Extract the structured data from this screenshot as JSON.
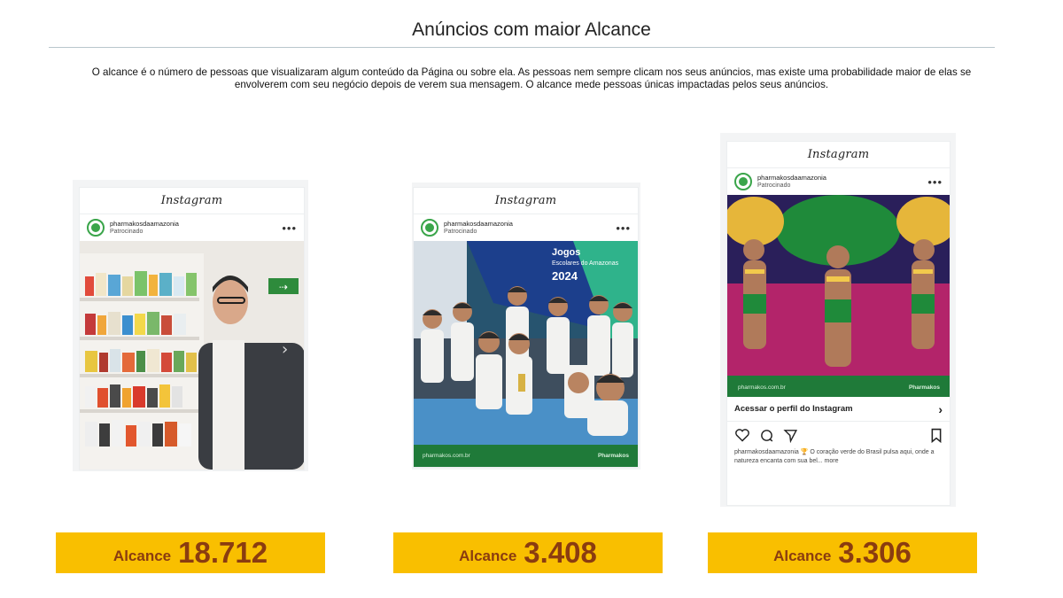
{
  "header": {
    "title": "Anúncios com maior Alcance",
    "description": "O alcance é o número de pessoas que visualizaram algum conteúdo da Página ou sobre ela. As pessoas nem sempre clicam nos seus anúncios, mas existe uma probabilidade maior de elas se envolverem com seu negócio depois de verem sua mensagem. O alcance mede pessoas únicas impactadas pelos seus anúncios."
  },
  "colors": {
    "metric_bg": "#f9bf00",
    "metric_text": "#8a3c10",
    "brand_green": "#1f7a39"
  },
  "ads": [
    {
      "platform": "Instagram",
      "account": "pharmakosdaamazonia",
      "sponsored": "Patrocinado",
      "metric_label": "Alcance",
      "metric_value": "18.712"
    },
    {
      "platform": "Instagram",
      "account": "pharmakosdaamazonia",
      "sponsored": "Patrocinado",
      "banner_text": "Jogos",
      "banner_sub": "Escolares do Amazonas",
      "banner_year": "2024",
      "footer_link": "pharmakos.com.br",
      "footer_brand": "Pharmakos",
      "metric_label": "Alcance",
      "metric_value": "3.408"
    },
    {
      "platform": "Instagram",
      "account": "pharmakosdaamazonia",
      "sponsored": "Patrocinado",
      "footer_link": "pharmakos.com.br",
      "footer_brand": "Pharmakos",
      "profile_link": "Acessar o perfil do Instagram",
      "caption": "pharmakosdaamazonia 🏆 O coração verde do Brasil pulsa aqui, onde a natureza encanta com sua bel... more",
      "metric_label": "Alcance",
      "metric_value": "3.306"
    }
  ],
  "icons": [
    "heart-icon",
    "comment-icon",
    "share-icon",
    "bookmark-icon",
    "chevron-right-icon",
    "more-icon",
    "exit-sign-icon"
  ]
}
